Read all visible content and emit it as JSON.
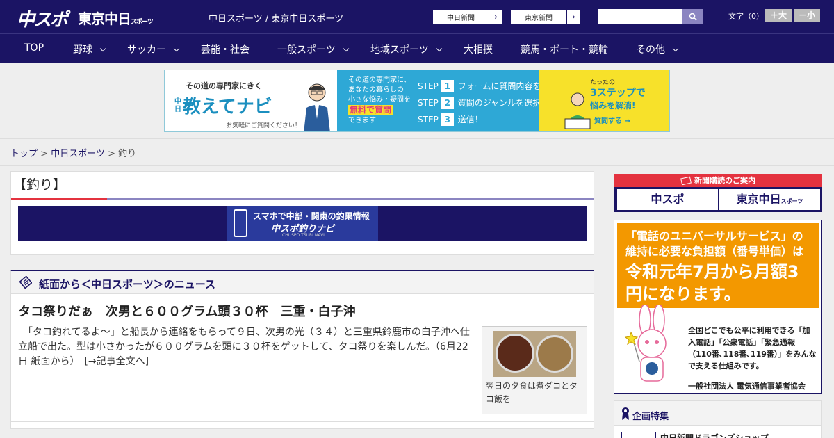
{
  "header": {
    "logo_chuspo": "中スポ",
    "logo_tokyo": "東京中日",
    "logo_tokyo_sub": "スポーツ",
    "site_title": "中日スポーツ / 東京中日スポーツ",
    "btn_chunichi": "中日新聞",
    "btn_tokyo": "東京新聞",
    "moji_label": "文字（0）",
    "moji_bigger": "＋大",
    "moji_smaller": "－小"
  },
  "nav": {
    "items": [
      {
        "label": "TOP",
        "dropdown": false
      },
      {
        "label": "野球",
        "dropdown": true
      },
      {
        "label": "サッカー",
        "dropdown": true
      },
      {
        "label": "芸能・社会",
        "dropdown": false
      },
      {
        "label": "一般スポーツ",
        "dropdown": true
      },
      {
        "label": "地域スポーツ",
        "dropdown": true
      },
      {
        "label": "大相撲",
        "dropdown": false
      },
      {
        "label": "競馬・ボート・競輪",
        "dropdown": false
      },
      {
        "label": "その他",
        "dropdown": true
      }
    ]
  },
  "banner": {
    "lead": "その道の専門家にきく",
    "brand_prefix": "中日",
    "brand": "教えてナビ",
    "note": "お気軽にご質問ください！",
    "desc_1": "その道の専門家に、",
    "desc_2": "あなたの暮らしの",
    "desc_3": "小さな悩み・疑問を",
    "desc_free": "無料で質問",
    "desc_4": "できます",
    "steps": [
      {
        "num": "1",
        "text": "フォームに質問内容を入力"
      },
      {
        "num": "2",
        "text": "質問のジャンルを選択"
      },
      {
        "num": "3",
        "text": "送信！"
      }
    ],
    "step_label": "STEP",
    "right_1": "たったの",
    "right_2": "3ステップで",
    "right_3": "悩みを解消!",
    "right_cta": "質問する →"
  },
  "breadcrumb": {
    "top": "トップ",
    "sep": " > ",
    "section": "中日スポーツ",
    "current": "釣り"
  },
  "category": {
    "title": "【釣り】",
    "fish_banner_1": "スマホで中部・関東の釣果情報",
    "fish_banner_2": "中スポ釣りナビ",
    "fish_banner_3": "CHUSPO TSURI NAVI"
  },
  "news": {
    "section_label": "紙面から＜中日スポーツ＞のニュース",
    "article_title": "タコ祭りだぁ　次男と６００グラム頭３０杯　三重・白子沖",
    "article_body": "　「タコ釣れてるよ～」と船長から連絡をもらって９日、次男の光（３４）と三重県鈴鹿市の白子沖へ仕立船で出た。型は小さかったが６００グラムを頭に３０杯をゲットして、タコ祭りを楽しんだ。（6月22日 紙面から）",
    "read_more": "　[→記事全文へ]",
    "thumb_caption": "翌日の夕食は煮ダコとタコ飯を"
  },
  "sidebar": {
    "subscribe_head": "新聞購読のご案内",
    "sub_chuspo": "中スポ",
    "sub_tokyo": "東京中日",
    "sub_tokyo_small": "スポーツ",
    "ad_line1": "「電話のユニバーサルサービス」の維持に必要な負担額（番号単価）は",
    "ad_line2": "令和元年7月から月額3円になります。",
    "ad_line3": "全国どこでも公平に利用できる「加入電話」「公衆電話」「緊急通報（110番､118番､119番）」をみんなで支える仕組みです。",
    "ad_line4": "一般社団法人 電気通信事業者協会",
    "features_title": "企画特集",
    "features_item": "中日新聞ドラゴンズショップ"
  },
  "colors": {
    "header_bg": "#1b1464",
    "accent_red": "#e4323f",
    "accent_purple": "#8b85c1",
    "banner_blue": "#2ea8d6",
    "banner_yellow": "#f7e12a",
    "ad_orange": "#f39800"
  }
}
